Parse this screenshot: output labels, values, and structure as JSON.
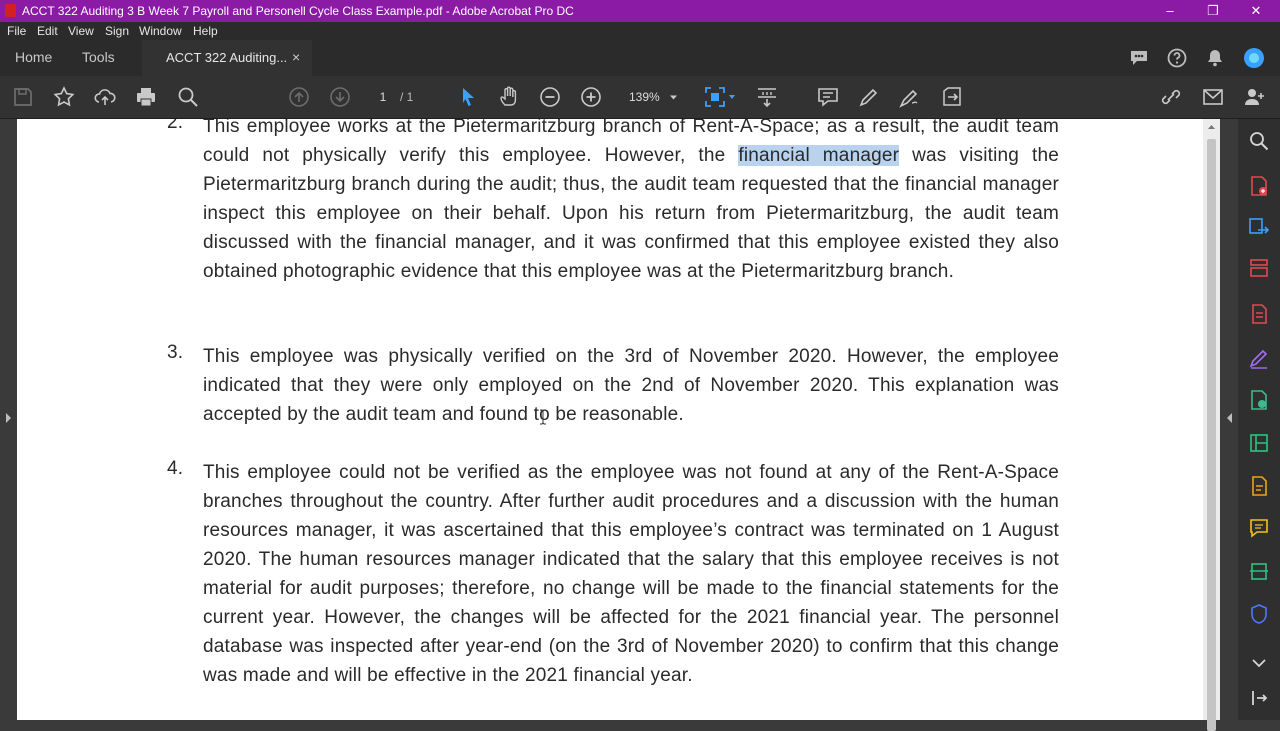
{
  "window": {
    "title": "ACCT 322 Auditing 3 B Week 7 Payroll and Personell Cycle Class Example.pdf - Adobe Acrobat Pro DC",
    "controls": [
      "–",
      "❐",
      "✕"
    ]
  },
  "menu": [
    "File",
    "Edit",
    "View",
    "Sign",
    "Window",
    "Help"
  ],
  "tabs": {
    "home": "Home",
    "tools": "Tools",
    "document": "ACCT 322 Auditing...",
    "close": "×"
  },
  "toolbar": {
    "current_page": "1",
    "page_total": "/ 1",
    "zoom": "139%"
  },
  "colors": {
    "title_bar": "#8b1aa5",
    "accent": "#3aa0ff",
    "highlight": "#b9d3ee"
  },
  "document": {
    "items": [
      {
        "number": "2.",
        "text_before": "This employee works at the Pietermaritzburg branch of Rent-A-Space; as a result, the audit team could not physically verify this employee. However, the ",
        "highlight": "financial manager",
        "text_after": " was visiting the Pietermaritzburg branch during the audit; thus, the audit team requested that the financial manager inspect this employee on their behalf. Upon his return from Pietermaritzburg, the audit team discussed with the financial manager, and it was confirmed that this employee existed they also obtained photographic evidence that this employee was at the Pietermaritzburg branch."
      },
      {
        "number": "3.",
        "text": "This employee was physically verified on the 3rd of November 2020. However, the employee indicated that they were only employed on the 2nd of November 2020. This explanation was accepted by the audit team and found to be reasonable."
      },
      {
        "number": "4.",
        "text": "This employee could not be verified as the employee was not found at any of the Rent-A-Space branches throughout the country.  After further audit procedures and a discussion with the human resources manager, it was ascertained that this employee’s contract was terminated on 1 August 2020. The human resources manager indicated that the salary that this employee receives is not material for audit purposes; therefore, no change will be made to the financial statements for the current year. However, the changes will be affected for the 2021 financial year. The personnel database was inspected after year-end (on the 3rd of November 2020) to confirm that this change was made and will be effective in the 2021 financial year."
      }
    ]
  }
}
